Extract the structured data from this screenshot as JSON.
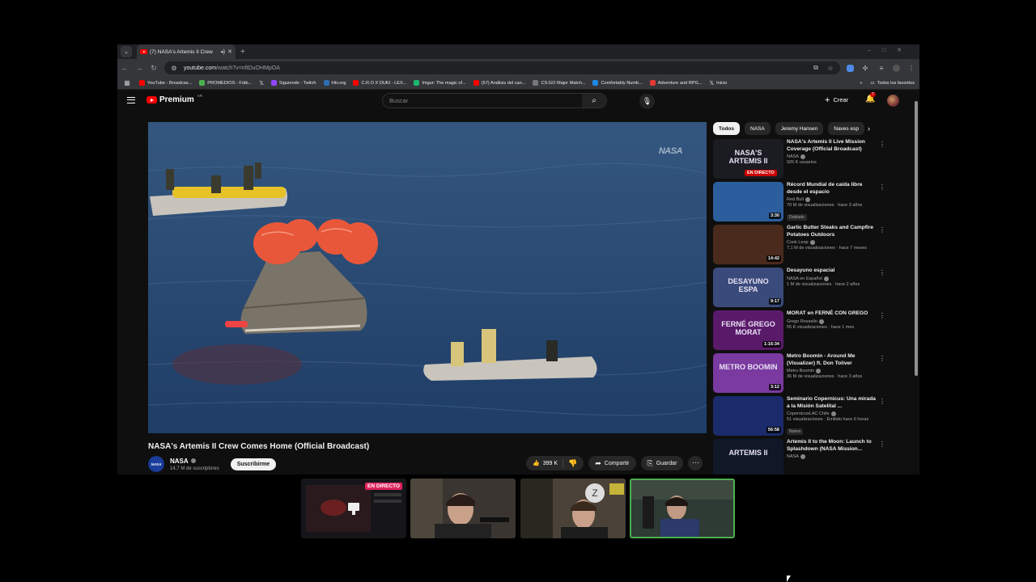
{
  "browser": {
    "tab_title": "(7) NASA's Artemis II Crew",
    "url_host": "youtube.com",
    "url_path": "/watch?v=nftDuOHMpOA",
    "bookmarks": [
      {
        "label": "YouTube - Broadcas...",
        "color": "#ff0000"
      },
      {
        "label": "PROMEDIOS - Fútb...",
        "color": "#4caf50"
      },
      {
        "label": "",
        "color": "#888888"
      },
      {
        "label": "Siguiendo - Twitch",
        "color": "#9146ff"
      },
      {
        "label": "hltv.org",
        "color": "#2d6db5"
      },
      {
        "label": "C.R.O X DUKI - LEX...",
        "color": "#ff0000"
      },
      {
        "label": "Imgur: The magic of...",
        "color": "#1bb76e"
      },
      {
        "label": "(57) Análisis del can...",
        "color": "#ff0000"
      },
      {
        "label": "CS:GO Major Match...",
        "color": "#777777"
      },
      {
        "label": "Comfortably Numb...",
        "color": "#1e88e5"
      },
      {
        "label": "Adventure and RPG...",
        "color": "#e53935"
      },
      {
        "label": "Inicio",
        "color": "#888888"
      }
    ],
    "all_bookmarks": "Todos los favoritos"
  },
  "header": {
    "logo": "Premium",
    "logo_sup": "AR",
    "search_placeholder": "Buscar",
    "create": "Crear",
    "notifications": "7"
  },
  "video": {
    "watermark": "NASA",
    "title": "NASA's Artemis II Crew Comes Home (Official Broadcast)",
    "channel": "NASA",
    "channel_logo": "NASA",
    "subscribers": "14,7 M de suscriptores",
    "subscribe": "Suscribirme",
    "likes": "399 K",
    "share": "Compartir",
    "save": "Guardar"
  },
  "chips": [
    "Todos",
    "NASA",
    "Jeremy Hansen",
    "Naves esp"
  ],
  "recommendations": [
    {
      "title": "NASA's Artemis II Live Mission Coverage (Official Broadcast)",
      "channel": "NASA",
      "views": "926 K usuarios",
      "badge": "EN DIRECTO",
      "thumb": "#1b1b22",
      "thumb_text": "NASA'S ARTEMIS II"
    },
    {
      "title": "Récord Mundial de caída libre desde el espacio",
      "channel": "Red Bull",
      "views": "70 M de visualizaciones · hace 3 años",
      "duration": "3:30",
      "tag": "Doblado",
      "thumb": "#2c5e9e",
      "thumb_text": ""
    },
    {
      "title": "Garlic Butter Steaks and Campfire Potatoes Outdoors",
      "channel": "Cook Loop",
      "views": "7,1 M de visualizaciones · hace 7 meses",
      "duration": "14:42",
      "thumb": "#4a2a1c",
      "thumb_text": ""
    },
    {
      "title": "Desayuno espacial",
      "channel": "NASA en Español",
      "views": "1 M de visualizaciones · hace 2 años",
      "duration": "9:17",
      "thumb": "#3a4a7a",
      "thumb_text": "DESAYUNO ESPA"
    },
    {
      "title": "MORAT en FERNÉ CON GREGO",
      "channel": "Grego Rossello",
      "views": "55 K visualizaciones · hace 1 mes",
      "duration": "1:16:34",
      "thumb": "#5a1a6a",
      "thumb_text": "FERNÉ GREGO MORAT"
    },
    {
      "title": "Metro Boomin - Around Me (Visualizer) ft. Don Toliver",
      "channel": "Metro Boomin",
      "views": "36 M de visualizaciones · hace 3 años",
      "duration": "3:12",
      "thumb": "#7a3aa0",
      "thumb_text": "METRO BOOMIN"
    },
    {
      "title": "Seminario Copernicus: Una mirada a la Misión Satelital ...",
      "channel": "CopernicusLAC Chile",
      "views": "51 visualizaciones · Emitido hace 6 horas",
      "duration": "56:58",
      "tag": "Nuevo",
      "thumb": "#1a2a6a",
      "thumb_text": ""
    },
    {
      "title": "Artemis II to the Moon: Launch to Splashdown (NASA Mission...",
      "channel": "NASA",
      "views": "",
      "thumb": "#101828",
      "thumb_text": "ARTEMIS II"
    }
  ],
  "participants": [
    {
      "badge": "EN DIRECTO",
      "color": "#16161a"
    },
    {
      "color": "#3a3530"
    },
    {
      "color": "#4a4238"
    },
    {
      "color": "#2e3a34"
    }
  ]
}
